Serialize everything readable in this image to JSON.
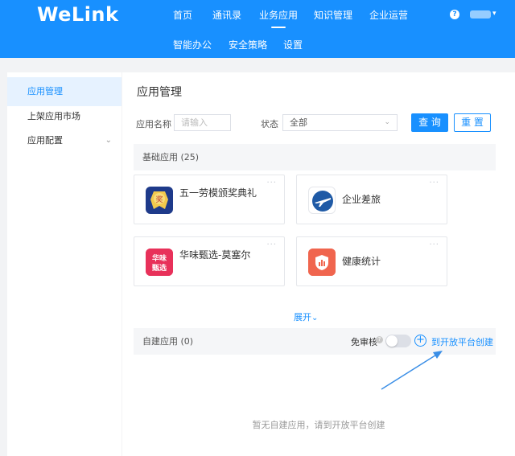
{
  "header": {
    "logo": "WeLink",
    "nav": [
      "首页",
      "通讯录",
      "业务应用",
      "知识管理",
      "企业运营",
      "智能办公",
      "安全策略",
      "设置"
    ],
    "active_nav": "业务应用",
    "help_symbol": "?",
    "bg_color": "#1890ff"
  },
  "sidebar": {
    "items": [
      {
        "label": "应用管理",
        "active": true
      },
      {
        "label": "上架应用市场",
        "active": false
      },
      {
        "label": "应用配置",
        "active": false,
        "expandable": true
      }
    ]
  },
  "main": {
    "title": "应用管理",
    "filter": {
      "name_label": "应用名称",
      "name_placeholder": "请输入",
      "status_label": "状态",
      "status_value": "全部",
      "query_button": "查 询",
      "reset_button": "重 置"
    },
    "builtin": {
      "header": "基础应用 (25)",
      "apps": [
        {
          "name": "五一劳模颁奖典礼",
          "icon": "award-badge-icon"
        },
        {
          "name": "企业差旅",
          "icon": "airplane-icon"
        },
        {
          "name": "华味甄选-莫塞尔",
          "icon": "huawei-select-icon",
          "icon_text": "华味甄选"
        },
        {
          "name": "健康统计",
          "icon": "health-shield-icon"
        }
      ],
      "more_symbol": "···",
      "expand_label": "展开"
    },
    "custom": {
      "header": "自建应用 (0)",
      "audit_label": "免审核",
      "audit_enabled": false,
      "create_label": "到开放平台创建",
      "empty_text": "暂无自建应用，请到开放平台创建"
    }
  },
  "colors": {
    "primary": "#1890ff",
    "section_bg": "#f5f6f8",
    "award_icon": "#1e3a8a",
    "plane_icon": "#1f5aa6",
    "huawei_icon": "#e8315a",
    "health_icon": "#f0654e"
  }
}
